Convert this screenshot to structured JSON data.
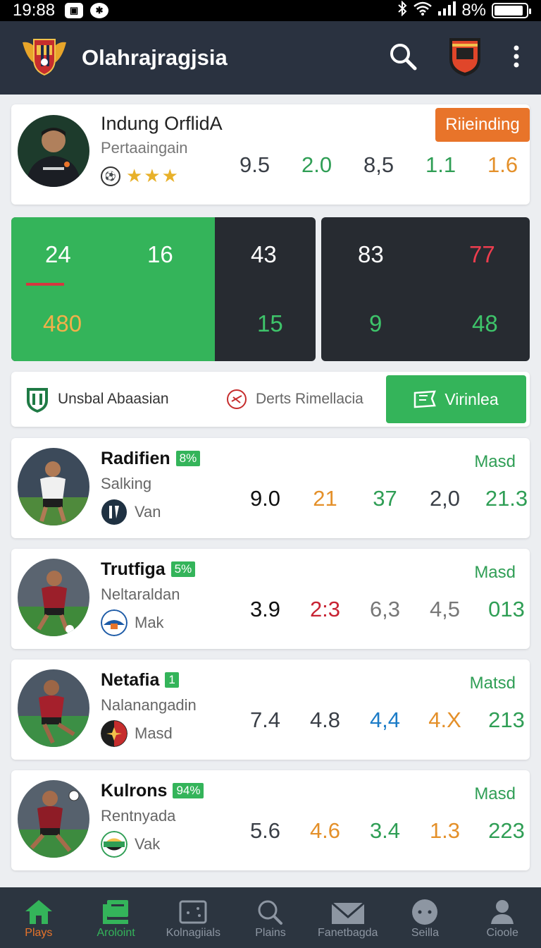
{
  "status_bar": {
    "time": "19:88",
    "battery": "8%",
    "battery_level": 0.9
  },
  "app_bar": {
    "title": "Olahrajragjsia"
  },
  "featured": {
    "name": "Indung OrflidA",
    "subtitle": "Pertaaingain",
    "button_label": "Riieinding",
    "stats": [
      "9.5",
      "2.0",
      "8,5",
      "1.1",
      "1.6"
    ]
  },
  "scoreboard": {
    "panel1": {
      "top": [
        "24",
        "16",
        "43"
      ],
      "bottom": [
        "480",
        "15"
      ]
    },
    "panel2": {
      "top": [
        "83",
        "77"
      ],
      "bottom": [
        "9",
        "48"
      ]
    }
  },
  "tabs": [
    "Unsbal Abaasian",
    "Derts Rimellacia",
    "Virinlea"
  ],
  "players": [
    {
      "name": "Radifien",
      "badge": "8%",
      "position": "Salking",
      "team": "Van",
      "status": "Masd",
      "stats": [
        "9.0",
        "21",
        "37",
        "2,0",
        "21.3"
      ]
    },
    {
      "name": "Trutfiga",
      "badge": "5%",
      "position": "Neltaraldan",
      "team": "Mak",
      "status": "Masd",
      "stats": [
        "3.9",
        "2:3",
        "6,3",
        "4,5",
        "013"
      ]
    },
    {
      "name": "Netafia",
      "badge": "1",
      "position": "Nalanangadin",
      "team": "Masd",
      "status": "Matsd",
      "stats": [
        "7.4",
        "4.8",
        "4,4",
        "4.X",
        "213"
      ]
    },
    {
      "name": "Kulrons",
      "badge": "94%",
      "position": "Rentnyada",
      "team": "Vak",
      "status": "Masd",
      "stats": [
        "5.6",
        "4.6",
        "3.4",
        "1.3",
        "223"
      ]
    }
  ],
  "bottom_nav": [
    "Plays",
    "Aroloint",
    "Kolnagiials",
    "Plains",
    "Fanetbagda",
    "Seilla",
    "Cioole"
  ],
  "colors": {
    "appbar": "#2a3240",
    "accent_green": "#34b45a",
    "accent_orange": "#e8742a",
    "nav_bg": "#2c3540"
  }
}
